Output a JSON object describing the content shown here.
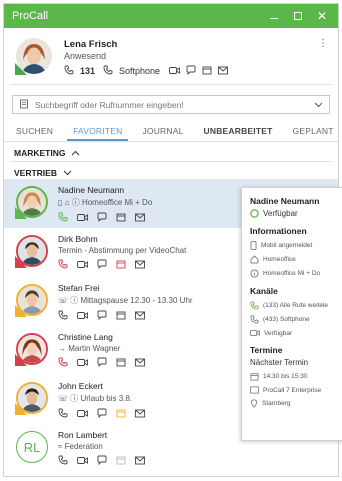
{
  "app": {
    "title": "ProCall"
  },
  "me": {
    "name": "Lena Frisch",
    "status": "Anwesend",
    "extension": "131",
    "softphone_label": "Softphone"
  },
  "search": {
    "placeholder": "Suchbegriff oder Rufnummer eingeben!"
  },
  "tabs": [
    {
      "label": "SUCHEN"
    },
    {
      "label": "FAVORITEN"
    },
    {
      "label": "JOURNAL"
    },
    {
      "label": "UNBEARBEITET"
    },
    {
      "label": "GEPLANT"
    }
  ],
  "groups": [
    {
      "label": "MARKETING"
    },
    {
      "label": "VERTRIEB"
    }
  ],
  "contacts": [
    {
      "name": "Nadine Neumann",
      "sub": "Homeoffice Mi + Do",
      "status_color": "#5cb74a"
    },
    {
      "name": "Dirk Bohm",
      "sub": "Termin - Abstimmung per VideoChat",
      "status_color": "#d6404a"
    },
    {
      "name": "Stefan Frei",
      "sub": "Mittagspause 12.30 - 13.30 Uhr",
      "status_color": "#f0b030"
    },
    {
      "name": "Christine Lang",
      "sub": "Martin Wagner",
      "status_color": "#d6404a"
    },
    {
      "name": "John Eckert",
      "sub": "Urlaub bis 3.8.",
      "status_color": "#f0b030"
    },
    {
      "name": "Ron Lambert",
      "sub": "Federation",
      "initials": "RL",
      "status_color": "#5cb74a"
    }
  ],
  "popup": {
    "name": "Nadine Neumann",
    "availability": "Verfügbar",
    "info_heading": "Informationen",
    "info_items": [
      "Mobil angemeldet",
      "Homeoffice",
      "Homeoffice Mi + Do"
    ],
    "channels_heading": "Kanäle",
    "channel_items": [
      "(133) Alle Rufe weitele",
      "(433) Softphone",
      "Verfügbar"
    ],
    "appointments_heading": "Termine",
    "next_appointment_label": "Nächster Termin",
    "appointment_items": [
      "14:30 bis 15:30",
      "ProCall 7 Enterprise",
      "Starnberg"
    ]
  },
  "colors": {
    "accent": "#5cb74a",
    "link": "#5b9bd5",
    "selected_row": "#dde8f2"
  },
  "icons": {
    "phone": "phone-icon",
    "video": "video-icon",
    "chat": "chat-icon",
    "calendar": "calendar-icon",
    "mail": "mail-icon",
    "info": "info-icon",
    "home": "home-icon",
    "mobile": "mobile-icon",
    "location": "location-icon"
  }
}
